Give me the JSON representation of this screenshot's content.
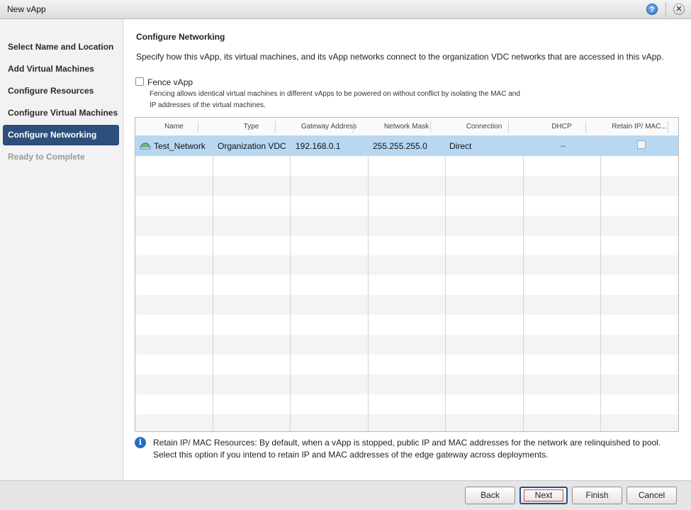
{
  "window": {
    "title": "New vApp",
    "help_icon": "?",
    "close_icon": "✕"
  },
  "sidebar": {
    "steps": [
      {
        "label": "Select Name and Location",
        "state": "normal"
      },
      {
        "label": "Add Virtual Machines",
        "state": "normal"
      },
      {
        "label": "Configure Resources",
        "state": "normal"
      },
      {
        "label": "Configure Virtual Machines",
        "state": "normal"
      },
      {
        "label": "Configure Networking",
        "state": "active"
      },
      {
        "label": "Ready to Complete",
        "state": "disabled"
      }
    ]
  },
  "main": {
    "heading": "Configure Networking",
    "description": "Specify how this vApp, its virtual machines, and its vApp networks connect to the organization VDC networks that are accessed in this vApp.",
    "fence": {
      "label": "Fence vApp",
      "checked": false,
      "help_line1": "Fencing allows identical virtual machines in different vApps to be powered on without conflict by isolating the MAC and",
      "help_line2": "IP addresses of the virtual machines."
    },
    "table": {
      "columns": [
        "Name",
        "Type",
        "Gateway Address",
        "Network Mask",
        "Connection",
        "DHCP",
        "Retain IP/ MAC..."
      ],
      "rows": [
        {
          "name": "Test_Network",
          "type": "Organization VDC",
          "gateway": "192.168.0.1",
          "mask": "255.255.255.0",
          "connection": "Direct",
          "dhcp": "–",
          "retain": false,
          "selected": true
        }
      ]
    },
    "info": {
      "line1": "Retain IP/ MAC Resources: By default, when a vApp is stopped, public IP and MAC addresses for the network are relinquished to pool.",
      "line2": "Select this option if you intend to retain IP and MAC addresses of the edge gateway across deployments."
    }
  },
  "footer": {
    "back": "Back",
    "next": "Next",
    "finish": "Finish",
    "cancel": "Cancel"
  },
  "colors": {
    "accent": "#2c4f7c",
    "selection": "#b7d8f3",
    "next_focus": "#d1435b"
  }
}
